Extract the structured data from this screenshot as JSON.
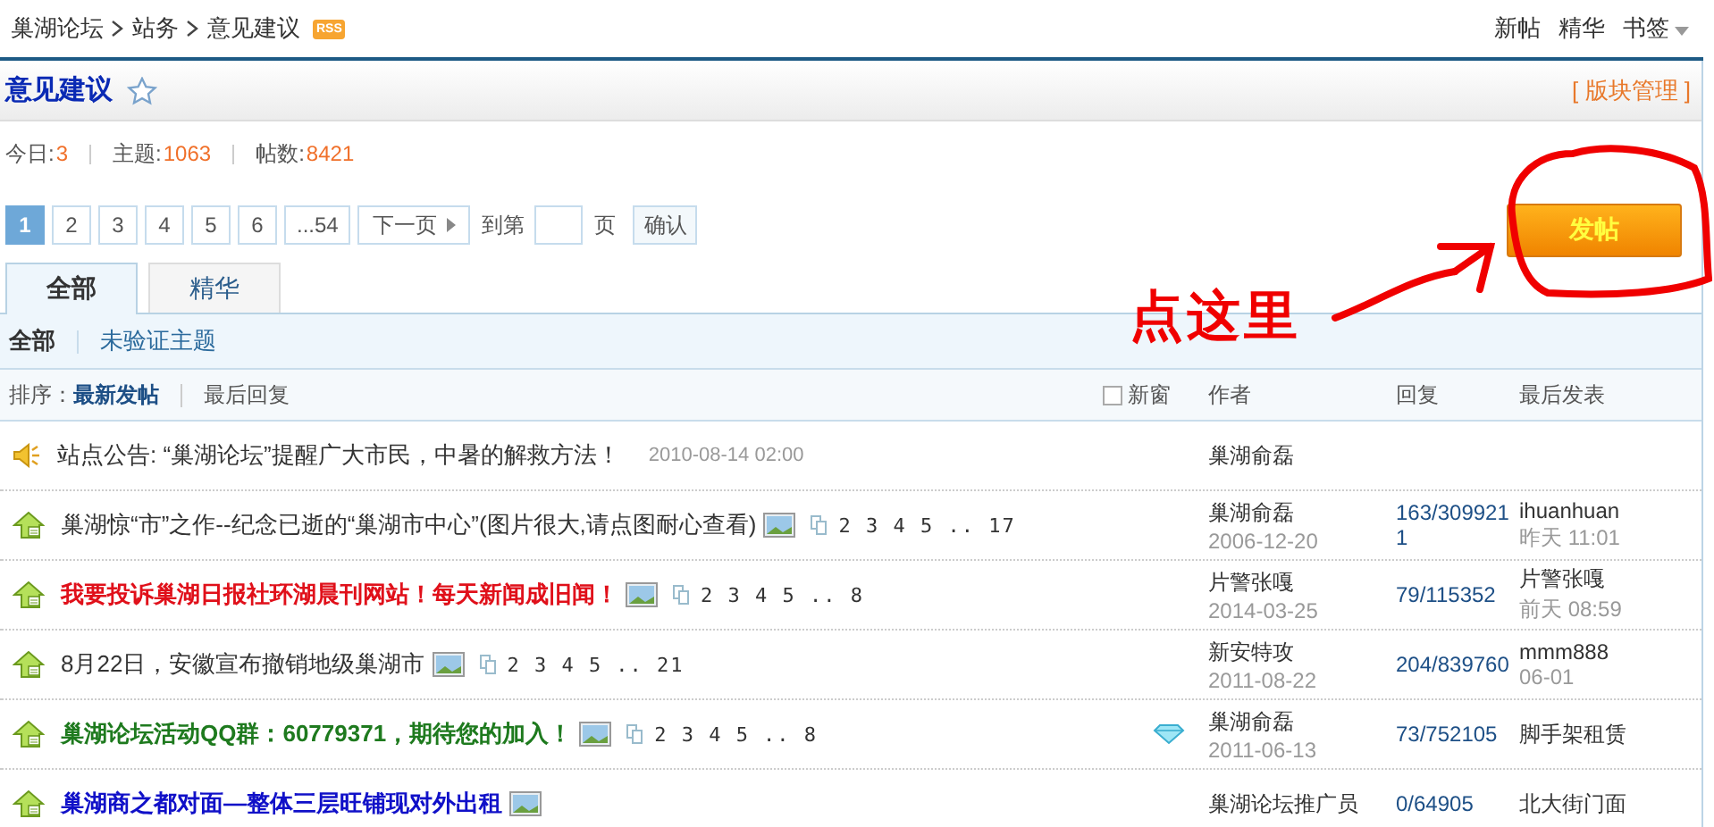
{
  "breadcrumb": {
    "items": [
      "巢湖论坛",
      "站务",
      "意见建议"
    ],
    "rss": "RSS"
  },
  "top_links": [
    {
      "label": "新帖",
      "dropdown": false
    },
    {
      "label": "精华",
      "dropdown": false
    },
    {
      "label": "书签",
      "dropdown": true
    }
  ],
  "forum": {
    "title": "意见建议",
    "manage": "[ 版块管理 ]"
  },
  "stats": [
    {
      "label": "今日:",
      "value": "3"
    },
    {
      "label": "主题:",
      "value": "1063"
    },
    {
      "label": "帖数:",
      "value": "8421"
    }
  ],
  "pager": {
    "pages": [
      {
        "label": "1",
        "selected": true
      },
      {
        "label": "2",
        "selected": false
      },
      {
        "label": "3",
        "selected": false
      },
      {
        "label": "4",
        "selected": false
      },
      {
        "label": "5",
        "selected": false
      },
      {
        "label": "6",
        "selected": false
      },
      {
        "label": "...54",
        "selected": false
      }
    ],
    "next": "下一页",
    "goto": "到第",
    "suffix": "页",
    "confirm": "确认"
  },
  "post_button": "发帖",
  "annotation": "点这里",
  "tabs": [
    {
      "label": "全部",
      "selected": true
    },
    {
      "label": "精华",
      "selected": false
    }
  ],
  "filters": [
    {
      "label": "全部",
      "selected": true
    },
    {
      "label": "未验证主题",
      "selected": false
    }
  ],
  "sort": {
    "label": "排序：",
    "options": [
      {
        "label": "最新发帖",
        "selected": true
      },
      {
        "label": "最后回复",
        "selected": false
      }
    ]
  },
  "columns": {
    "new_window": {
      "label": "新窗",
      "checked": false
    },
    "author": "作者",
    "replies": "回复",
    "last": "最后发表"
  },
  "threads": [
    {
      "kind": "announcement",
      "title": "站点公告: “巢湖论坛”提醒广大市民，中暑的解救方法！",
      "date": "2010-08-14 02:00",
      "author": "巢湖俞磊"
    },
    {
      "kind": "topic",
      "title": "巢湖惊“市”之作--纪念已逝的“巢湖市中心”(图片很大,请点图耐心查看)",
      "has_image": true,
      "pages": "2 3 4 5 .. 17",
      "author": "巢湖俞磊",
      "author_date": "2006-12-20",
      "replies": "163/3099211",
      "last_poster": "ihuanhuan",
      "last_date": "昨天 11:01"
    },
    {
      "kind": "topic",
      "title": "我要投诉巢湖日报社环湖晨刊网站！每天新闻成旧闻！",
      "color": "#e0101a",
      "has_image": true,
      "pages": "2 3 4 5 .. 8",
      "author": "片警张嘎",
      "author_date": "2014-03-25",
      "replies": "79/115352",
      "last_poster": "片警张嘎",
      "last_date": "前天 08:59"
    },
    {
      "kind": "topic",
      "title": "8月22日，安徽宣布撤销地级巢湖市",
      "has_image": true,
      "pages": "2 3 4 5 .. 21",
      "author": "新安特攻",
      "author_date": "2011-08-22",
      "replies": "204/839760",
      "last_poster": "mmm888",
      "last_date": "06-01"
    },
    {
      "kind": "topic",
      "title": "巢湖论坛活动QQ群：60779371，期待您的加入！",
      "color": "#1e7a1e",
      "has_image": true,
      "pages": "2 3 4 5 .. 8",
      "featured": true,
      "author": "巢湖俞磊",
      "author_date": "2011-06-13",
      "replies": "73/752105",
      "last_poster": "脚手架租赁"
    },
    {
      "kind": "topic",
      "title": "巢湖商之都对面—整体三层旺铺现对外出租",
      "color": "#1010c8",
      "has_image": true,
      "author": "巢湖论坛推广员",
      "replies": "0/64905",
      "last_poster": "北大街门面"
    }
  ]
}
